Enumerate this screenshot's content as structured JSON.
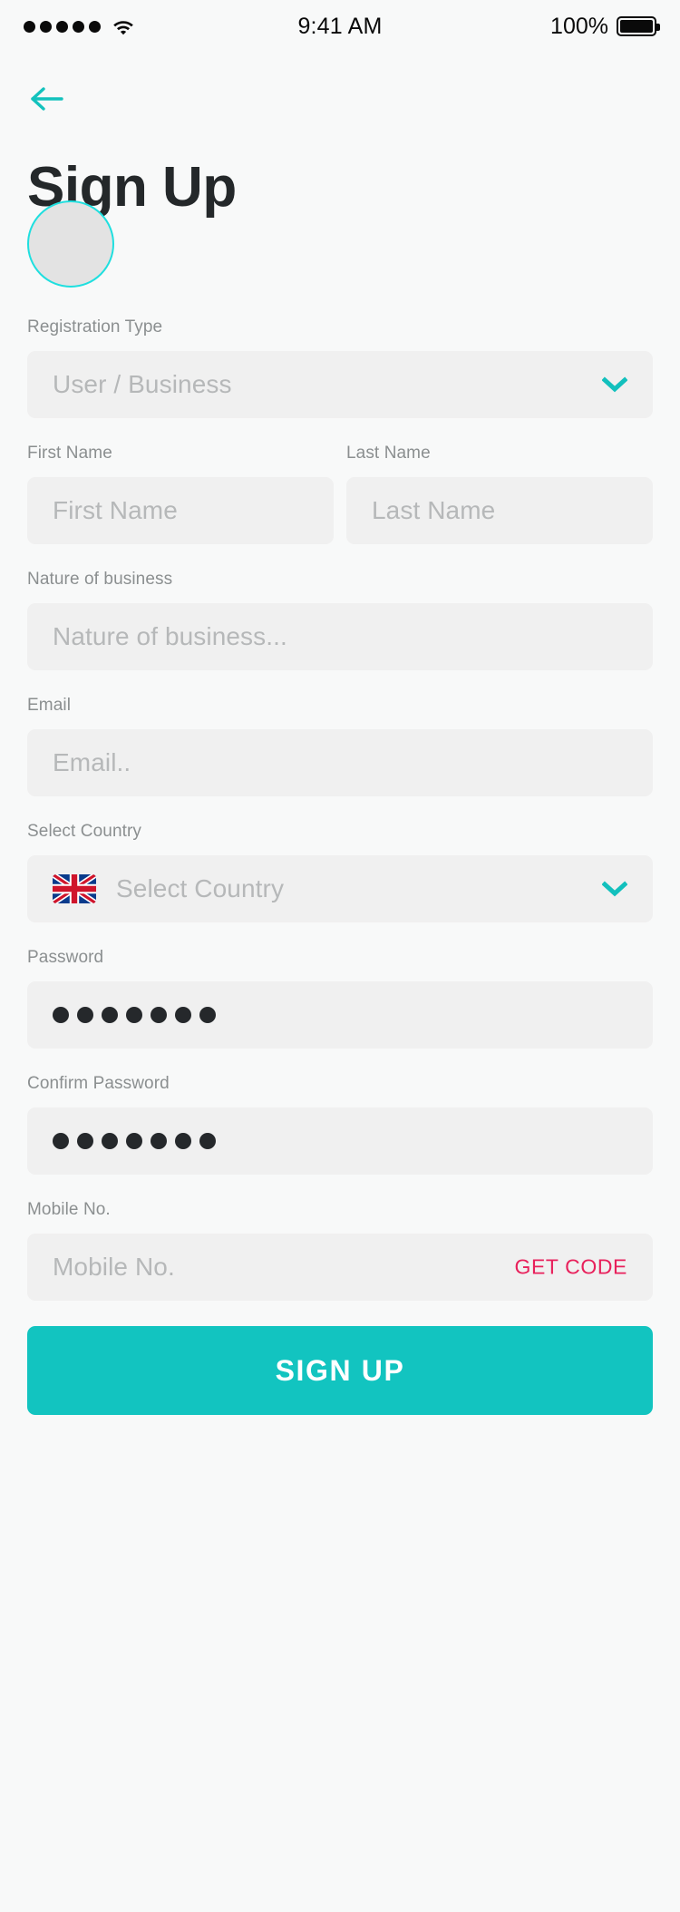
{
  "status_bar": {
    "signal_dots": 5,
    "wifi_icon": "wifi-icon",
    "time": "9:41 AM",
    "battery_percent": "100%",
    "battery_icon": "battery-full-icon"
  },
  "header": {
    "back_icon": "arrow-left-icon",
    "title": "Sign Up",
    "avatar_icon": "avatar-placeholder"
  },
  "colors": {
    "accent_teal": "#12c4c0",
    "avatar_border": "#1fdfdf",
    "chevron": "#12c0bd",
    "get_code_pink": "#e8205b",
    "page_background": "#f8f9f9",
    "field_background": "#f0f0f0",
    "label_gray": "#8b8f90",
    "placeholder_gray": "#b6b8b9",
    "title_dark": "#24282a"
  },
  "form": {
    "registration_type": {
      "label": "Registration Type",
      "placeholder": "User / Business",
      "value": "",
      "chevron_icon": "chevron-down-icon"
    },
    "first_name": {
      "label": "First Name",
      "placeholder": "First Name",
      "value": ""
    },
    "last_name": {
      "label": "Last Name",
      "placeholder": "Last Name",
      "value": ""
    },
    "nature_of_business": {
      "label": "Nature of business",
      "placeholder": "Nature of business...",
      "value": ""
    },
    "email": {
      "label": "Email",
      "placeholder": "Email..",
      "value": ""
    },
    "country": {
      "label": "Select Country",
      "placeholder": "Select Country",
      "value": "",
      "flag_icon": "uk-flag-icon",
      "chevron_icon": "chevron-down-icon"
    },
    "password": {
      "label": "Password",
      "masked_char_count": 7,
      "value": "•••••••"
    },
    "confirm_password": {
      "label": "Confirm Password",
      "masked_char_count": 7,
      "value": "•••••••"
    },
    "mobile": {
      "label": "Mobile No.",
      "placeholder": "Mobile No.",
      "value": "",
      "get_code_label": "GET CODE"
    },
    "submit_label": "SIGN UP"
  }
}
